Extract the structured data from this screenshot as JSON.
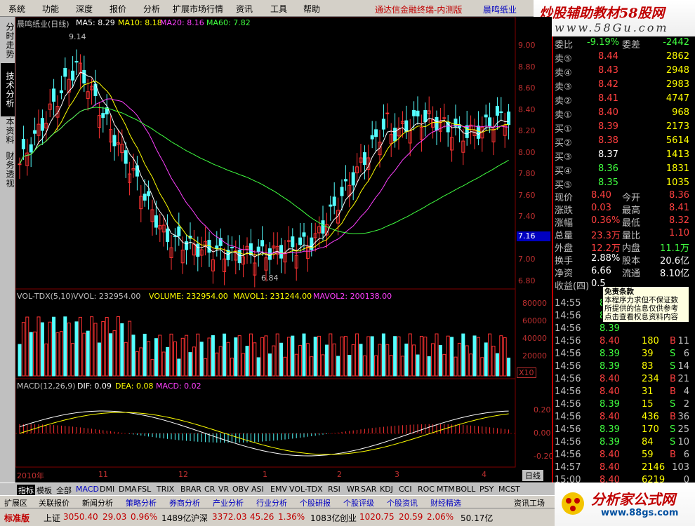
{
  "menu": [
    "系统",
    "功能",
    "深度",
    "报价",
    "分析",
    "扩展市场行情",
    "资讯",
    "工具",
    "帮助"
  ],
  "app_title": "通达信金融终端-内测版",
  "stock_name_title": "晨鸣纸业",
  "banner": {
    "title": "炒股辅助教材58股网",
    "url": "www.58Gu.com"
  },
  "side_tabs": [
    "分时走势",
    "技术分析",
    "基本资料",
    "财务透视"
  ],
  "kline": {
    "header": {
      "name": "晨鸣纸业(日线)",
      "ma5": "MA5: 8.29",
      "ma10": "MA10: 8.18",
      "ma20": "MA20: 8.16",
      "ma60": "MA60: 7.82"
    },
    "price_ticks": [
      "9.00",
      "8.80",
      "8.60",
      "8.40",
      "8.20",
      "8.00",
      "7.80",
      "7.60",
      "7.40",
      "7.20",
      "7.00",
      "6.80"
    ],
    "current_price_tag": "7.16",
    "high_label": "9.14",
    "low_label": "6.84"
  },
  "volume": {
    "header": {
      "name": "VOL-TDX(5,10)",
      "vvol": "VVOL: 232954.00",
      "volume": "VOLUME: 232954.00",
      "mavol1": "MAVOL1: 231244.00",
      "mavol2": "MAVOL2: 200138.00"
    },
    "ticks": [
      "80000",
      "60000",
      "40000",
      "20000"
    ],
    "unit": "X10"
  },
  "macd": {
    "header": {
      "name": "MACD(12,26,9)",
      "dif": "DIF: 0.09",
      "dea": "DEA: 0.08",
      "macd": "MACD: 0.02"
    },
    "ticks": [
      "0.20",
      "0.00",
      "-0.20"
    ]
  },
  "date_axis": [
    "2010年",
    "11",
    "12",
    "1",
    "2",
    "3",
    "4"
  ],
  "period": "日线",
  "quotes": {
    "weibi": {
      "label": "委比",
      "value": "-9.19%",
      "label2": "委差",
      "value2": "-2442"
    },
    "sells": [
      {
        "label": "卖⑤",
        "price": "8.44",
        "vol": "2862"
      },
      {
        "label": "卖④",
        "price": "8.43",
        "vol": "2948"
      },
      {
        "label": "卖③",
        "price": "8.42",
        "vol": "2983"
      },
      {
        "label": "卖②",
        "price": "8.41",
        "vol": "4747"
      },
      {
        "label": "卖①",
        "price": "8.40",
        "vol": "968"
      }
    ],
    "buys": [
      {
        "label": "买①",
        "price": "8.39",
        "vol": "2173"
      },
      {
        "label": "买②",
        "price": "8.38",
        "vol": "5614"
      },
      {
        "label": "买③",
        "price": "8.37",
        "vol": "1413"
      },
      {
        "label": "买④",
        "price": "8.36",
        "vol": "1831"
      },
      {
        "label": "买⑤",
        "price": "8.35",
        "vol": "1035"
      }
    ],
    "stats": [
      {
        "l1": "现价",
        "v1": "8.40",
        "l2": "今开",
        "v2": "8.36"
      },
      {
        "l1": "涨跌",
        "v1": "0.03",
        "l2": "最高",
        "v2": "8.41"
      },
      {
        "l1": "涨幅",
        "v1": "0.36%",
        "l2": "最低",
        "v2": "8.32"
      },
      {
        "l1": "总量",
        "v1": "23.3万",
        "l2": "量比",
        "v2": "1.10"
      },
      {
        "l1": "外盘",
        "v1": "12.2万",
        "l2": "内盘",
        "v2": "11.1万"
      },
      {
        "l1": "换手",
        "v1": "2.88%",
        "l2": "股本",
        "v2": "20.6亿"
      },
      {
        "l1": "净资",
        "v1": "6.66",
        "l2": "流通",
        "v2": "8.10亿"
      },
      {
        "l1": "收益(四)",
        "v1": "0.5",
        "l2": "",
        "v2": ""
      }
    ]
  },
  "tooltip": [
    "免责条款",
    "本程序力求但不保证数",
    "所提供的信息仅供参考",
    "点击查看权息资料内容"
  ],
  "ticks": [
    {
      "t": "14:55",
      "p": "8.39",
      "v": "2",
      "f": ""
    },
    {
      "t": "14:56",
      "p": "8.39",
      "v": "",
      "f": ""
    },
    {
      "t": "14:56",
      "p": "8.39",
      "v": "",
      "f": ""
    },
    {
      "t": "14:56",
      "p": "8.40",
      "v": "180",
      "f": "B",
      "n": "11"
    },
    {
      "t": "14:56",
      "p": "8.39",
      "v": "39",
      "f": "S",
      "n": "6"
    },
    {
      "t": "14:56",
      "p": "8.39",
      "v": "83",
      "f": "S",
      "n": "14"
    },
    {
      "t": "14:56",
      "p": "8.40",
      "v": "234",
      "f": "B",
      "n": "21"
    },
    {
      "t": "14:56",
      "p": "8.40",
      "v": "31",
      "f": "B",
      "n": "4"
    },
    {
      "t": "14:56",
      "p": "8.39",
      "v": "15",
      "f": "S",
      "n": "2"
    },
    {
      "t": "14:56",
      "p": "8.40",
      "v": "436",
      "f": "B",
      "n": "36"
    },
    {
      "t": "14:56",
      "p": "8.39",
      "v": "170",
      "f": "S",
      "n": "25"
    },
    {
      "t": "14:56",
      "p": "8.39",
      "v": "84",
      "f": "S",
      "n": "10"
    },
    {
      "t": "14:56",
      "p": "8.40",
      "v": "59",
      "f": "B",
      "n": "6"
    },
    {
      "t": "14:57",
      "p": "8.40",
      "v": "2146",
      "f": "",
      "n": "103"
    },
    {
      "t": "15:00",
      "p": "8.40",
      "v": "6219",
      "f": "",
      "n": "0"
    }
  ],
  "indicators": [
    "指标",
    "模板",
    "全部",
    "MACD",
    "DMI",
    "DMA",
    "FSL",
    "TRIX",
    "BRAR",
    "CR",
    "VR",
    "OBV",
    "ASI",
    "EMV",
    "VOL-TDX",
    "RSI",
    "WR",
    "SAR",
    "KDJ",
    "CCI",
    "ROC",
    "MTM",
    "BOLL",
    "PSY",
    "MCST"
  ],
  "tabs2": [
    "扩展区",
    "关联报价",
    "新闻分析",
    "策略分析",
    "券商分析",
    "产业分析",
    "行业分析",
    "个股研报",
    "个股评级",
    "个股资讯",
    "财经精选"
  ],
  "tab2_right": "资讯工场",
  "status": {
    "edition": "标准版",
    "sh_label": "上证",
    "sh_val": "3050.40",
    "sh_chg": "29.03",
    "sh_pct": "0.96%",
    "sh_amt": "1489亿",
    "sz_label": "沪深",
    "sz_val": "3372.03",
    "sz_chg": "45.26",
    "sz_pct": "1.36%",
    "sz_amt": "1083亿",
    "cy_label": "创业",
    "cy_val": "1020.75",
    "cy_chg": "20.59",
    "cy_pct": "2.06%",
    "cy_amt": "50.17亿"
  },
  "logo": {
    "text": "分析家公式网",
    "url": "www.88gs.com"
  }
}
